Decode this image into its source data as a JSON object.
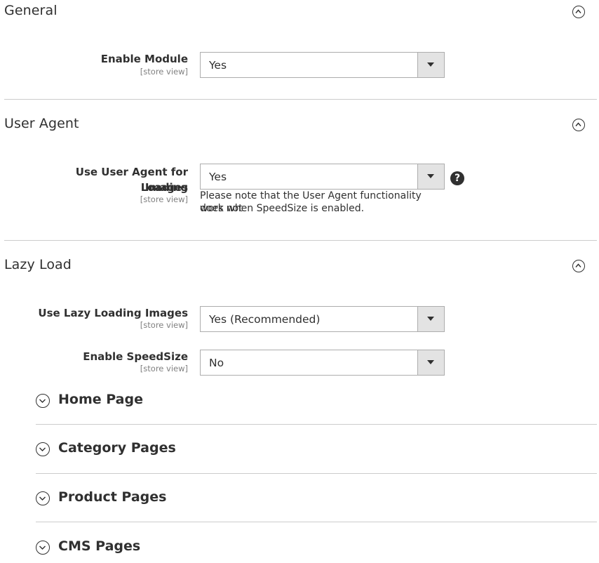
{
  "sections": {
    "general": {
      "title": "General",
      "fields": {
        "enable_module": {
          "label": "Enable Module",
          "scope": "[store view]",
          "value": "Yes"
        }
      }
    },
    "user_agent": {
      "title": "User Agent",
      "fields": {
        "use_user_agent": {
          "label_line1": "Use User Agent for Loading",
          "label_line2": "Images",
          "scope": "[store view]",
          "value": "Yes",
          "note_line1": "Please note that the User Agent functionality does not",
          "note_line2": "work when SpeedSize is enabled.",
          "help_glyph": "?"
        }
      }
    },
    "lazy_load": {
      "title": "Lazy Load",
      "fields": {
        "use_lazy_loading": {
          "label": "Use Lazy Loading Images",
          "scope": "[store view]",
          "value": "Yes (Recommended)"
        },
        "enable_speedsize": {
          "label": "Enable SpeedSize",
          "scope": "[store view]",
          "value": "No"
        }
      },
      "groups": [
        {
          "label": "Home Page"
        },
        {
          "label": "Category Pages"
        },
        {
          "label": "Product Pages"
        },
        {
          "label": "CMS Pages"
        }
      ]
    }
  },
  "icons": {
    "collapse": "chevron-up-circle-icon",
    "expand": "chevron-down-circle-icon",
    "select_arrow": "caret-down-icon",
    "help": "question-circle-icon"
  },
  "colors": {
    "text": "#303030",
    "muted": "#808080",
    "border": "#adadad",
    "divider": "#cccccc",
    "select_button_bg": "#e3e3e3"
  }
}
